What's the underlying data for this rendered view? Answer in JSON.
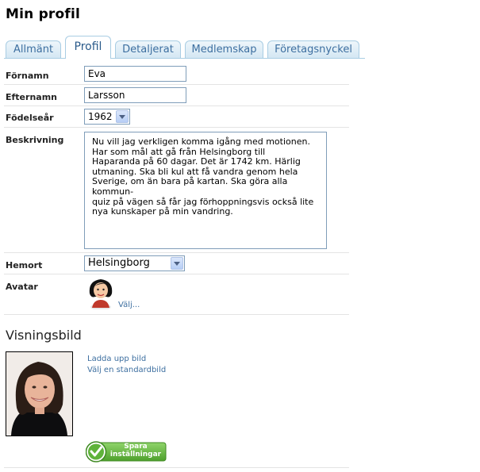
{
  "page": {
    "title": "Min profil"
  },
  "tabs": [
    {
      "label": "Allmänt",
      "active": false
    },
    {
      "label": "Profil",
      "active": true
    },
    {
      "label": "Detaljerat",
      "active": false
    },
    {
      "label": "Medlemskap",
      "active": false
    },
    {
      "label": "Företagsnyckel",
      "active": false
    }
  ],
  "form": {
    "first_name": {
      "label": "Förnamn",
      "value": "Eva"
    },
    "last_name": {
      "label": "Efternamn",
      "value": "Larsson"
    },
    "birth_year": {
      "label": "Födelseår",
      "value": "1962"
    },
    "description": {
      "label": "Beskrivning",
      "value": "Nu vill jag verkligen komma igång med motionen.\nHar som mål att gå från Helsingborg till\nHaparanda på 60 dagar. Det är 1742 km. Härlig\nutmaning. Ska bli kul att få vandra genom hela\nSverige, om än bara på kartan. Ska göra alla kommun-\nquiz på vägen så får jag förhoppningsvis också lite\nnya kunskaper på min vandring."
    },
    "home_town": {
      "label": "Hemort",
      "value": "Helsingborg"
    },
    "avatar": {
      "label": "Avatar",
      "choose_link": "Välj..."
    }
  },
  "display_image": {
    "title": "Visningsbild",
    "upload_link": "Ladda upp bild",
    "default_link": "Välj en standardbild"
  },
  "save_button": {
    "label_line1": "Spara",
    "label_line2": "inställningar"
  },
  "colors": {
    "link": "#3d6fa0",
    "tab_border": "#a9cde3",
    "save_green": "#5fb33a"
  }
}
